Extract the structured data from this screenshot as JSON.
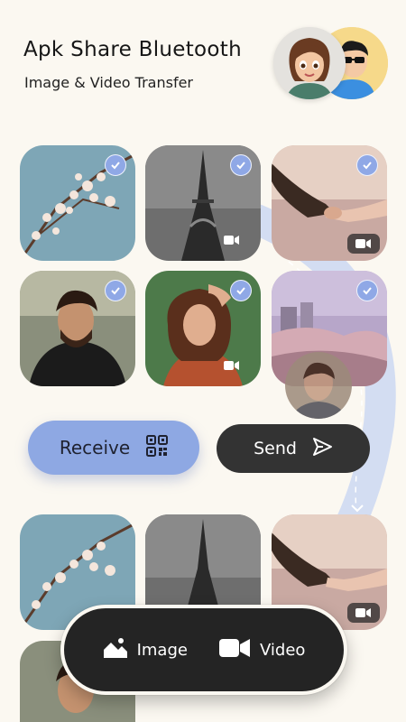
{
  "header": {
    "title": "Apk Share Bluetooth",
    "subtitle": "Image & Video Transfer"
  },
  "avatars": [
    "girl-avatar",
    "boy-avatar"
  ],
  "grid_top": [
    {
      "name": "cherry-blossom-photo",
      "selected": true,
      "video": false
    },
    {
      "name": "eiffel-tower-photo",
      "selected": true,
      "video": true
    },
    {
      "name": "holding-hands-photo",
      "selected": true,
      "video": true
    },
    {
      "name": "man-portrait-photo",
      "selected": true,
      "video": false
    },
    {
      "name": "woman-portrait-photo",
      "selected": true,
      "video": true
    },
    {
      "name": "city-park-photo",
      "selected": true,
      "video": false
    }
  ],
  "actions": {
    "receive_label": "Receive",
    "send_label": "Send"
  },
  "bottom_nav": {
    "image_label": "Image",
    "video_label": "Video"
  },
  "colors": {
    "background": "#fbf8f1",
    "accent": "#8ea8e3",
    "dark": "#242424"
  }
}
